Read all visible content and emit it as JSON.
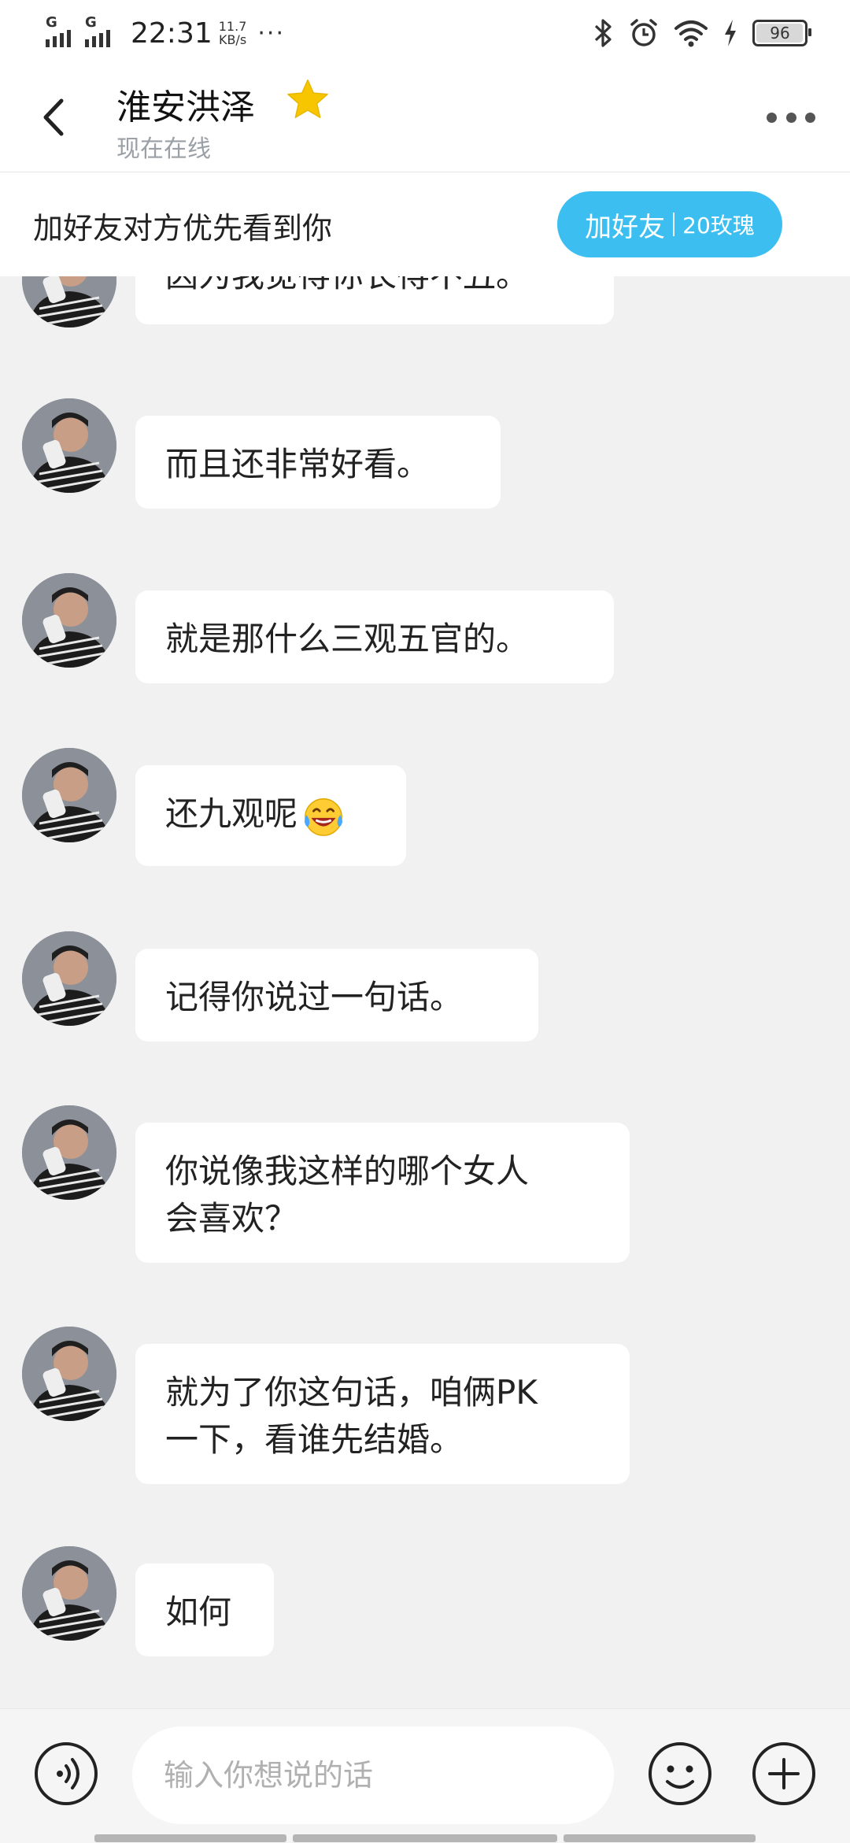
{
  "status_bar": {
    "signal1_label": "G",
    "signal2_label": "G",
    "time": "22:31",
    "speed_value": "11.7",
    "speed_unit": "KB/s",
    "overflow": "···",
    "battery": "96"
  },
  "header": {
    "title": "淮安洪泽",
    "subtitle": "现在在线"
  },
  "banner": {
    "text": "加好友对方优先看到你",
    "button_main": "加好友",
    "button_cost": "20玫瑰"
  },
  "messages": [
    {
      "text": "因为我觉得你长得不丑。"
    },
    {
      "text": "而且还非常好看。"
    },
    {
      "text": "就是那什么三观五官的。"
    },
    {
      "text": "还九观呢"
    },
    {
      "text": "记得你说过一句话。"
    },
    {
      "text": "你说像我这样的哪个女人",
      "text2": "会喜欢？"
    },
    {
      "text": "就为了你这句话，咱俩PK",
      "text2": "一下，看谁先结婚。"
    },
    {
      "text": "如何"
    }
  ],
  "input": {
    "placeholder": "输入你想说的话"
  },
  "colors": {
    "accent": "#3cbff0",
    "background": "#f1f1f1",
    "bubble": "#ffffff",
    "star": "#f7c600"
  },
  "icons": [
    "back-arrow-icon",
    "star-icon",
    "more-icon",
    "voice-icon",
    "emoji-icon",
    "plus-icon",
    "bluetooth-icon",
    "alarm-icon",
    "wifi-icon",
    "charging-icon",
    "battery-icon",
    "laughing-tears-emoji"
  ]
}
